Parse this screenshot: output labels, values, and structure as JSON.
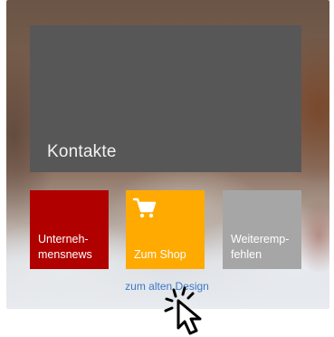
{
  "tiles": {
    "contacts": {
      "label": "Kontakte",
      "color": "#575757"
    },
    "news": {
      "label_line1": "Unterneh-",
      "label_line2": "mensnews",
      "color": "#b10000"
    },
    "shop": {
      "label": "Zum Shop",
      "icon": "shopping-cart-icon",
      "color": "#ffaa00"
    },
    "recommend": {
      "label_line1": "Weiteremp-",
      "label_line2": "fehlen",
      "color": "#a6a6a6"
    }
  },
  "footer": {
    "old_design_link": "zum alten Design",
    "link_color": "#3c78c8"
  },
  "cursor": {
    "icon": "click-pointer-icon"
  }
}
